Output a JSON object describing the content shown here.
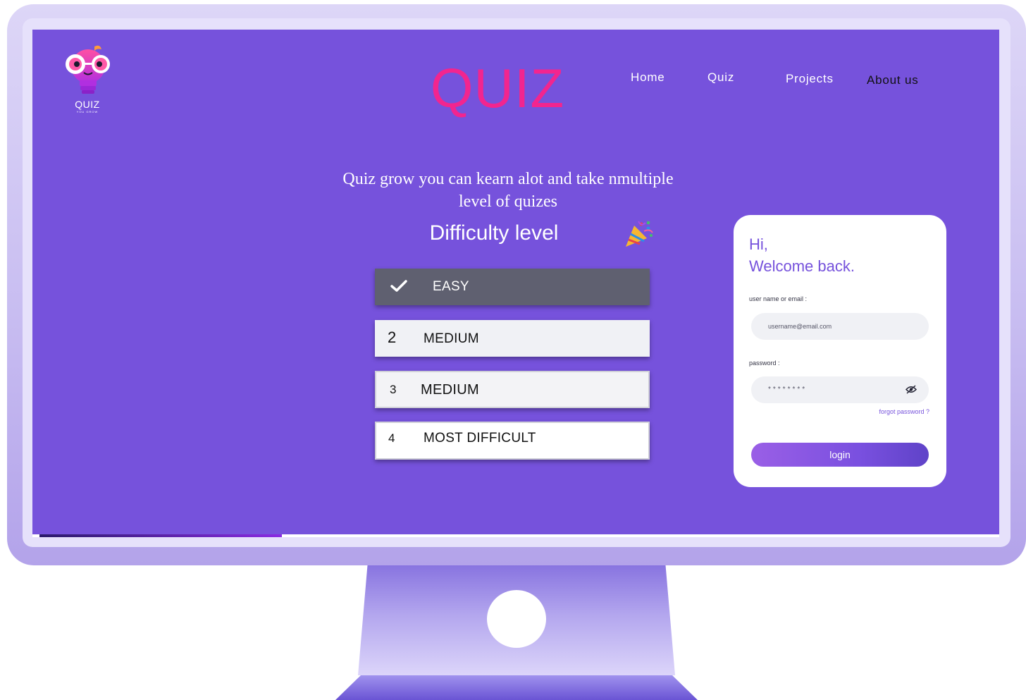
{
  "logo": {
    "title": "QUIZ",
    "subtitle": "YOU GROW"
  },
  "header": {
    "title": "QUIZ"
  },
  "nav": {
    "home": "Home",
    "quiz": "Quiz",
    "projects": "Projects",
    "about": "About us"
  },
  "hero": {
    "tagline_line1": "Quiz grow you can kearn alot and take nmultiple",
    "tagline_line2": "level of quizes",
    "difficulty_heading": "Difficulty level"
  },
  "levels": [
    {
      "marker": "check-icon",
      "label": "EASY",
      "selected": true
    },
    {
      "marker": "2",
      "label": "MEDIUM",
      "selected": false
    },
    {
      "marker": "3",
      "label": "MEDIUM",
      "selected": false
    },
    {
      "marker": "4",
      "label": "MOST DIFFICULT",
      "selected": false
    }
  ],
  "login": {
    "greeting_line1": "Hi,",
    "greeting_line2": "Welcome back.",
    "username_label": "user name or email :",
    "username_placeholder": "username@email.com",
    "password_label": "password :",
    "password_value": "********",
    "forgot_password": "forgot password ?",
    "login_button": "login"
  },
  "colors": {
    "screen_background": "#7652dc",
    "title_pink": "#f2258f",
    "selected_level": "#5f6070",
    "accent_purple": "#7652dc"
  }
}
